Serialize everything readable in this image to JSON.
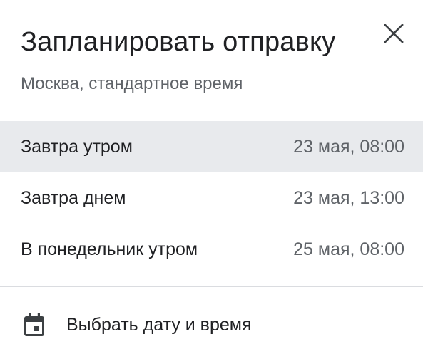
{
  "dialog": {
    "title": "Запланировать отправку",
    "subtitle": "Москва, стандартное время",
    "close_icon": "close-icon"
  },
  "options": [
    {
      "label": "Завтра утром",
      "time": "23 мая, 08:00",
      "highlighted": true
    },
    {
      "label": "Завтра днем",
      "time": "23 мая, 13:00",
      "highlighted": false
    },
    {
      "label": "В понедельник утром",
      "time": "25 мая, 08:00",
      "highlighted": false
    }
  ],
  "custom": {
    "label": "Выбрать дату и время",
    "icon": "calendar-icon"
  },
  "colors": {
    "highlight": "#e8eaed",
    "text_primary": "#202124",
    "text_secondary": "#5f6368",
    "divider": "#dadce0"
  }
}
